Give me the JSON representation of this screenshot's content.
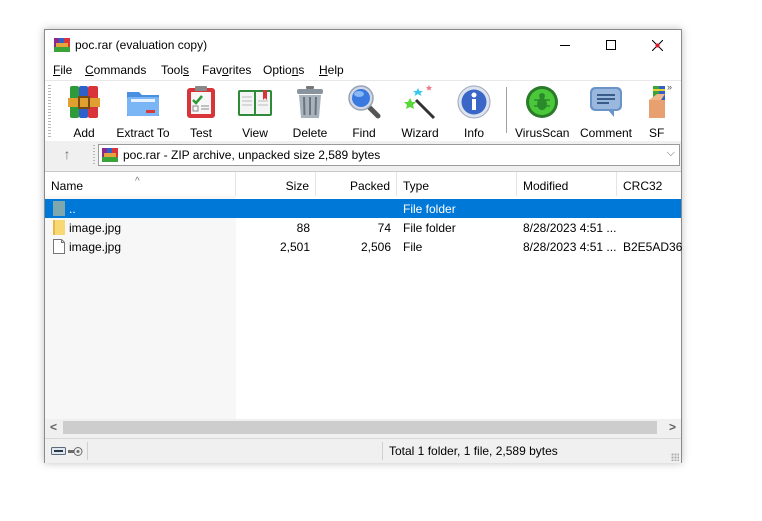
{
  "window": {
    "title": "poc.rar (evaluation copy)",
    "controls": {
      "minimize": "minimize-icon",
      "maximize": "maximize-icon",
      "close": "close-icon"
    }
  },
  "menu": [
    {
      "label": "File",
      "mnemonic": "F",
      "rest": "ile"
    },
    {
      "label": "Commands",
      "mnemonic": "C",
      "rest": "ommands"
    },
    {
      "label": "Tools",
      "pre": "Tool",
      "mnemonic": "s"
    },
    {
      "label": "Favorites",
      "pre": "Fav",
      "mnemonic": "o",
      "rest": "rites"
    },
    {
      "label": "Options",
      "pre": "Optio",
      "mnemonic": "n",
      "rest": "s"
    },
    {
      "label": "Help",
      "mnemonic": "H",
      "rest": "elp"
    }
  ],
  "toolbar": {
    "buttons": [
      {
        "label": "Add",
        "icon": "add-archive-icon"
      },
      {
        "label": "Extract To",
        "icon": "extract-folder-icon"
      },
      {
        "label": "Test",
        "icon": "test-clipboard-icon"
      },
      {
        "label": "View",
        "icon": "view-book-icon"
      },
      {
        "label": "Delete",
        "icon": "delete-trash-icon"
      },
      {
        "label": "Find",
        "icon": "find-magnifier-icon"
      },
      {
        "label": "Wizard",
        "icon": "wizard-wand-icon"
      },
      {
        "label": "Info",
        "icon": "info-icon"
      },
      {
        "label": "VirusScan",
        "icon": "virusscan-bug-icon"
      },
      {
        "label": "Comment",
        "icon": "comment-bubble-icon"
      },
      {
        "label": "SF",
        "icon": "sfx-box-icon"
      }
    ],
    "overflow": "»"
  },
  "address": {
    "up": "↑",
    "text": "poc.rar - ZIP archive, unpacked size 2,589 bytes",
    "dropdown": "⌵"
  },
  "columns": [
    "Name",
    "Size",
    "Packed",
    "Type",
    "Modified",
    "CRC32"
  ],
  "sort_indicator": "^",
  "rows": [
    {
      "name": "..",
      "size": "",
      "packed": "",
      "type": "File folder",
      "modified": "",
      "crc": "",
      "icon": "parent-folder-icon",
      "selected": true
    },
    {
      "name": "image.jpg",
      "size": "88",
      "packed": "74",
      "type": "File folder",
      "modified": "8/28/2023 4:51 ...",
      "crc": "",
      "icon": "folder-icon",
      "selected": false
    },
    {
      "name": "image.jpg",
      "size": "2,501",
      "packed": "2,506",
      "type": "File",
      "modified": "8/28/2023 4:51 ...",
      "crc": "B2E5AD36",
      "icon": "file-icon",
      "selected": false
    }
  ],
  "scrollbar": {
    "left": "<",
    "right": ">"
  },
  "status": {
    "text": "Total 1 folder, 1 file, 2,589 bytes"
  },
  "colors": {
    "selection": "#0078d7",
    "close_accent": "#e81123"
  }
}
